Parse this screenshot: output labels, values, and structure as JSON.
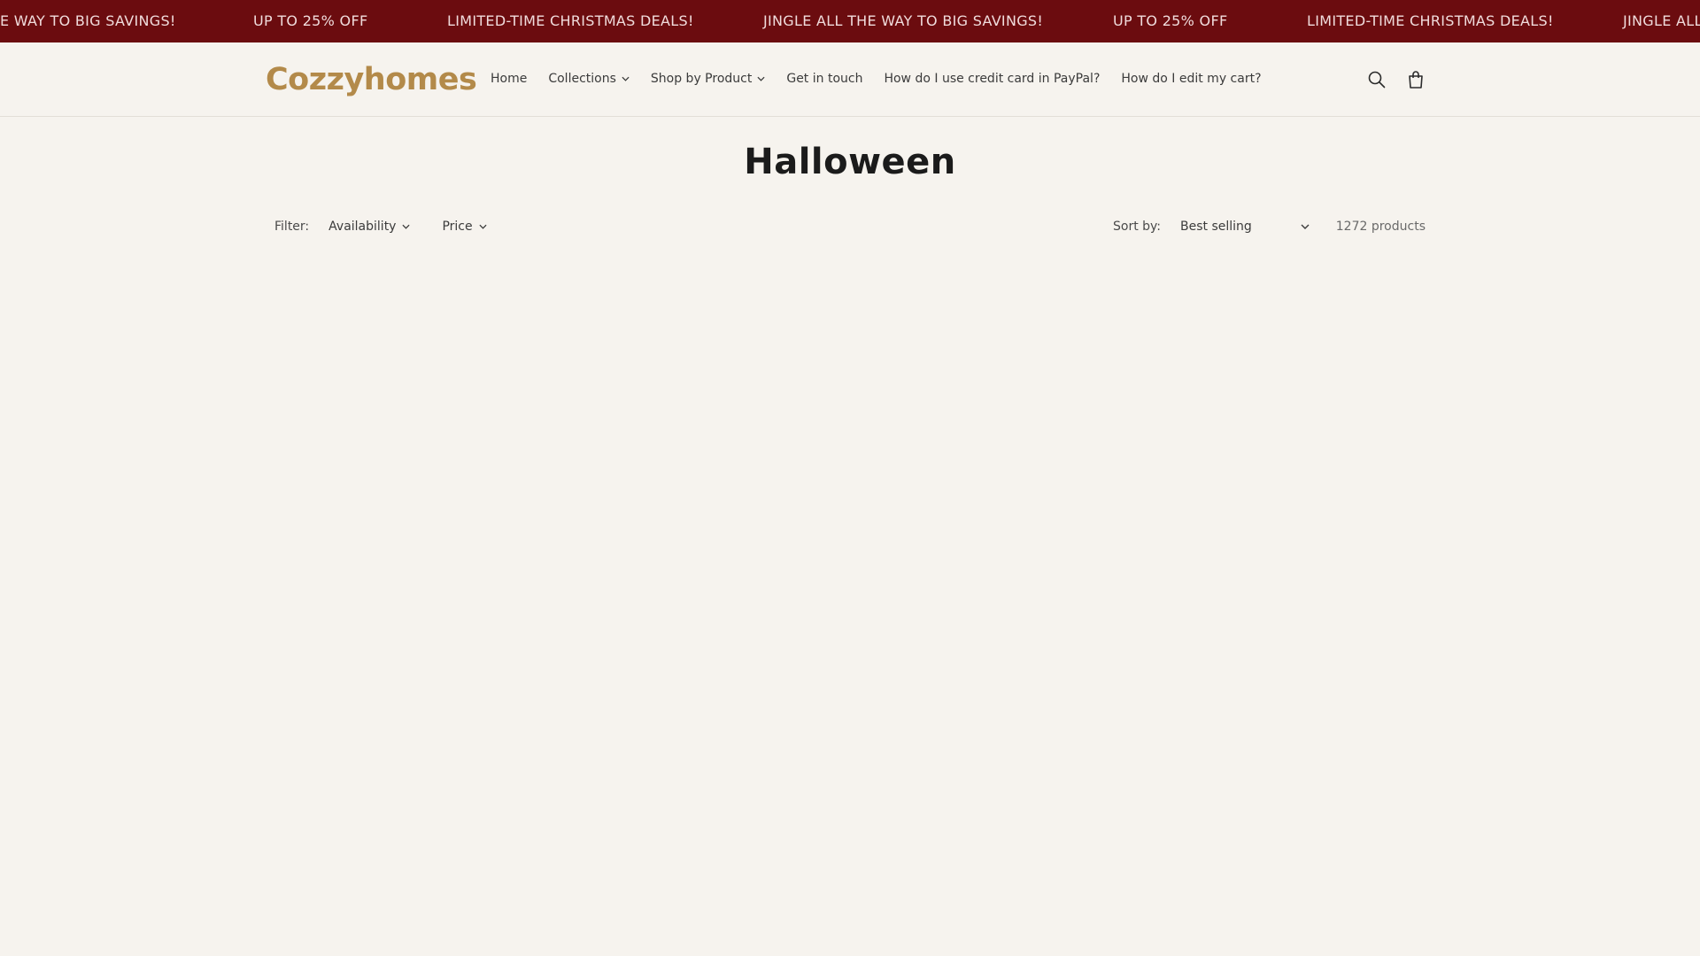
{
  "announcement": {
    "items": [
      "E WAY TO BIG SAVINGS!",
      "UP TO 25% OFF",
      "LIMITED-TIME CHRISTMAS DEALS!",
      "JINGLE ALL THE WAY TO BIG SAVINGS!",
      "UP TO 25% OFF",
      "LIMITED-TIME CHRISTMAS DEALS!",
      "JINGLE ALL"
    ],
    "background": "#6b0c0f"
  },
  "header": {
    "logo": "Cozzyhomes",
    "logo_color": "#b38a4a",
    "nav": [
      {
        "label": "Home"
      },
      {
        "label": "Collections"
      },
      {
        "label": "Shop by Product"
      },
      {
        "label": "Get in touch"
      },
      {
        "label": "How do I use credit card in PayPal?"
      },
      {
        "label": "How do I edit my cart?"
      }
    ],
    "icons": [
      "search-icon",
      "cart-icon"
    ]
  },
  "collection": {
    "title": "Halloween",
    "filter_label": "Filter:",
    "filters": [
      {
        "label": "Availability"
      },
      {
        "label": "Price"
      }
    ],
    "sort_label": "Sort by:",
    "sort_value": "Best selling",
    "product_count": "1272 products"
  }
}
